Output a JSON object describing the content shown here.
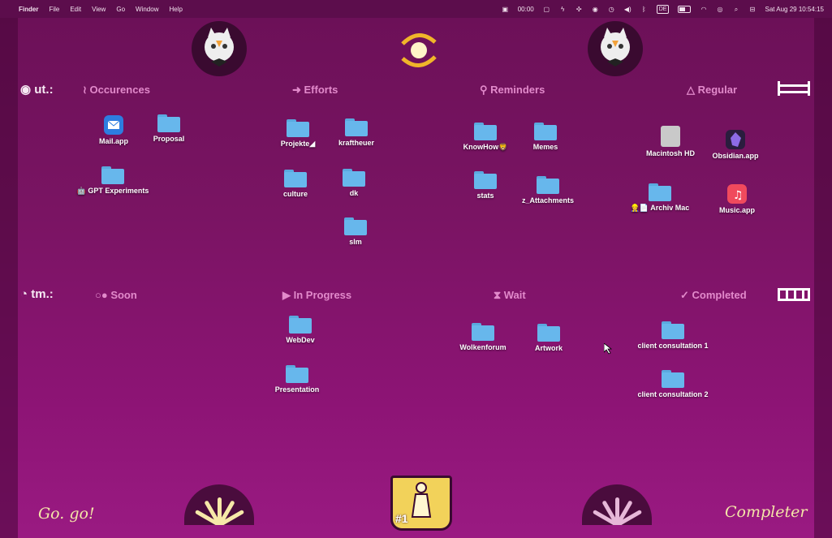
{
  "menubar": {
    "apple": "",
    "app": "Finder",
    "menus": [
      "File",
      "Edit",
      "View",
      "Go",
      "Window",
      "Help"
    ],
    "timer": "00:00",
    "keyboard": "DE",
    "datetime": "Sat Aug 29  10:54:15"
  },
  "headers": {
    "row_ut": {
      "label": "ut.:"
    },
    "occurences": "≀ Occurences",
    "efforts": "➜ Efforts",
    "reminders": "⚲ Reminders",
    "regular": "△ Regular",
    "row_tm": {
      "label": "tm.:"
    },
    "soon": "○● Soon",
    "in_progress": "▶ In Progress",
    "wait": "⧗ Wait",
    "completed": "✓ Completed"
  },
  "icons": [
    {
      "label": "Mail.app",
      "kind": "mail"
    },
    {
      "label": "Proposal",
      "kind": "folder"
    },
    {
      "label": "🤖 GPT Experiments",
      "kind": "folder"
    },
    {
      "label": "Projekte◢",
      "kind": "folder"
    },
    {
      "label": "kraftheuer",
      "kind": "folder"
    },
    {
      "label": "culture",
      "kind": "folder"
    },
    {
      "label": "dk",
      "kind": "folder"
    },
    {
      "label": "slm",
      "kind": "folder"
    },
    {
      "label": "KnowHow🦁",
      "kind": "folder"
    },
    {
      "label": "Memes",
      "kind": "folder"
    },
    {
      "label": "stats",
      "kind": "folder"
    },
    {
      "label": "z_Attachments",
      "kind": "folder"
    },
    {
      "label": "Macintosh HD",
      "kind": "disk"
    },
    {
      "label": "Obsidian.app",
      "kind": "obsidian"
    },
    {
      "label": "👷📄 Archiv Mac",
      "kind": "folder"
    },
    {
      "label": "Music.app",
      "kind": "music"
    },
    {
      "label": "WebDev",
      "kind": "folder"
    },
    {
      "label": "Presentation",
      "kind": "folder"
    },
    {
      "label": "Wolkenforum",
      "kind": "folder"
    },
    {
      "label": "Artwork",
      "kind": "folder"
    },
    {
      "label": "client consultation 1",
      "kind": "folder"
    },
    {
      "label": "client consultation 2",
      "kind": "folder"
    }
  ],
  "bottom": {
    "go": "Go. go!",
    "completer": "Completer",
    "trophy": "#1"
  },
  "colors": {
    "header": "#e28acb",
    "folder": "#67b7ec",
    "accent": "#f4e6a8"
  }
}
